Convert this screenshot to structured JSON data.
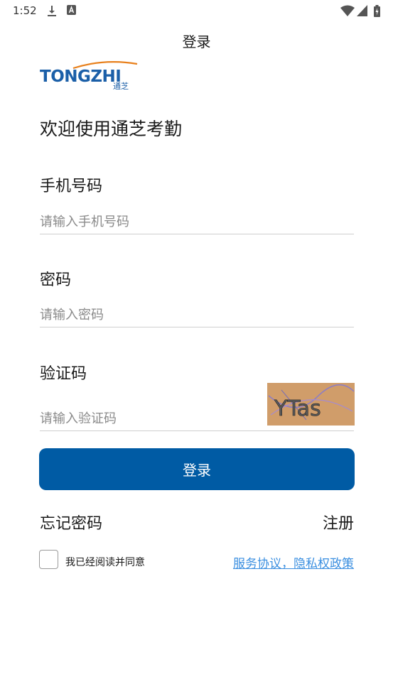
{
  "status_bar": {
    "time": "1:52",
    "icons": [
      "download-icon",
      "a-icon",
      "wifi-icon",
      "signal-icon",
      "battery-icon"
    ]
  },
  "app_bar": {
    "title": "登录"
  },
  "logo": {
    "brand_text": "TONGZHI",
    "brand_cn": "通芝"
  },
  "welcome": "欢迎使用通芝考勤",
  "phone": {
    "label": "手机号码",
    "placeholder": "请输入手机号码"
  },
  "password": {
    "label": "密码",
    "placeholder": "请输入密码"
  },
  "captcha": {
    "label": "验证码",
    "placeholder": "请输入验证码",
    "image_text": "YTas"
  },
  "login_button": "登录",
  "forgot_password": "忘记密码",
  "register": "注册",
  "agreement": {
    "text": "我已经阅读并同意",
    "link": "服务协议，隐私权政策",
    "checked": false
  },
  "colors": {
    "primary": "#005ba4",
    "link": "#3b8fe0",
    "captcha_bg": "#d09d6a"
  }
}
